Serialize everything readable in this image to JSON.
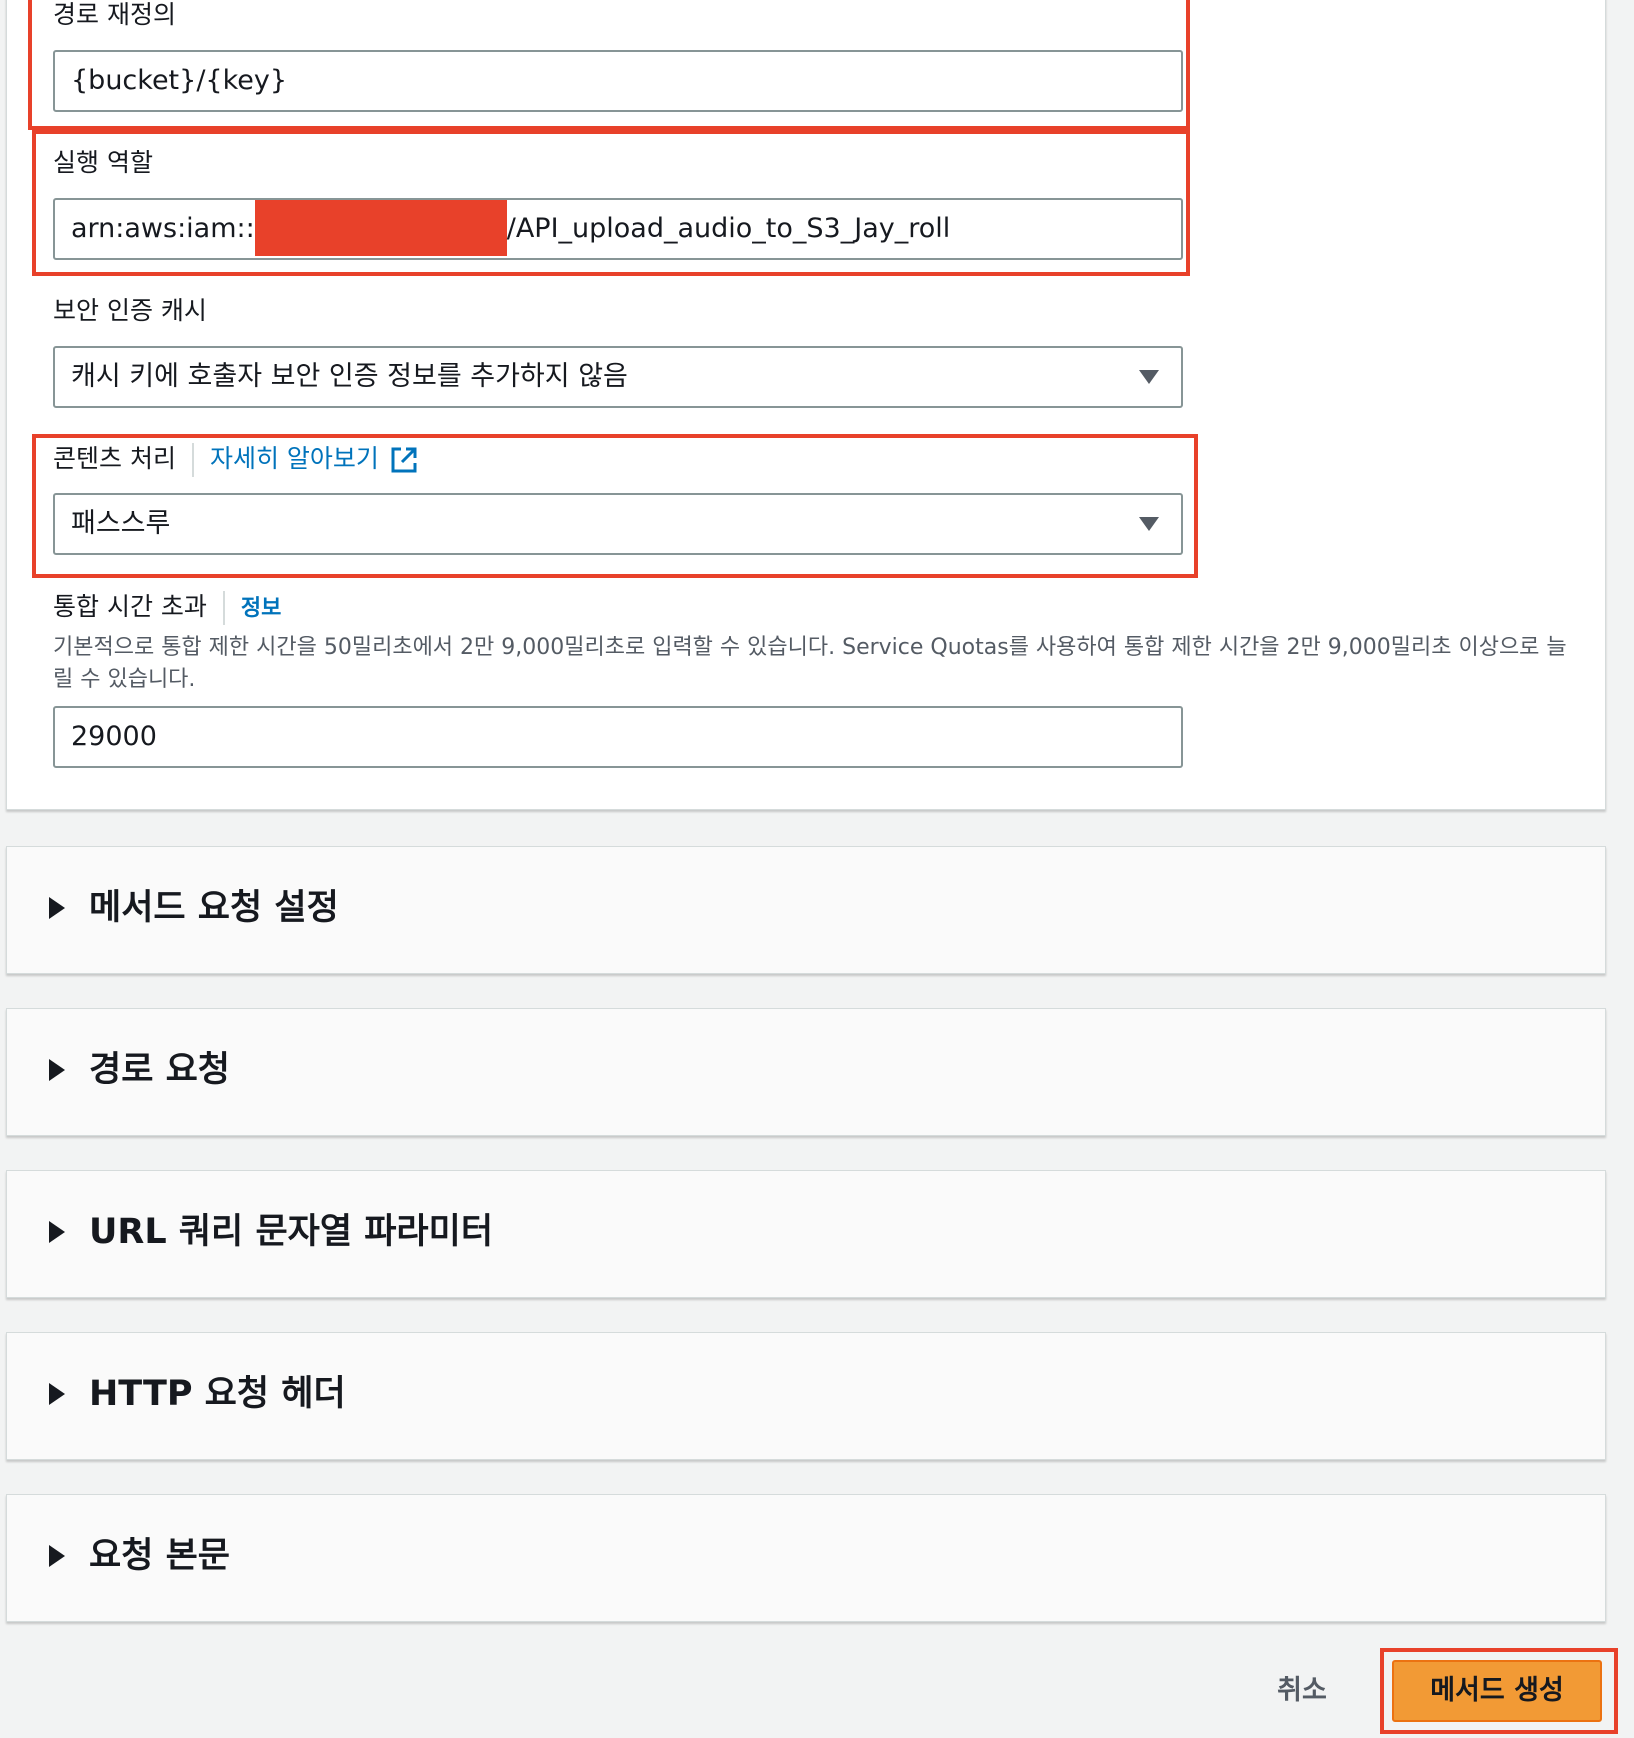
{
  "integration": {
    "path_override": {
      "label": "경로 재정의",
      "value": "{bucket}/{key}"
    },
    "execution_role": {
      "label": "실행 역할",
      "value_prefix": "arn:aws:iam::",
      "value_suffix": "/API_upload_audio_to_S3_Jay_roll"
    },
    "credential_cache": {
      "label": "보안 인증 캐시",
      "selected": "캐시 키에 호출자 보안 인증 정보를 추가하지 않음"
    },
    "content_handling": {
      "label": "콘텐츠 처리",
      "link": "자세히 알아보기",
      "selected": "패스스루"
    },
    "timeout": {
      "label": "통합 시간 초과",
      "info": "정보",
      "description": "기본적으로 통합 제한 시간을 50밀리초에서 2만 9,000밀리초로 입력할 수 있습니다. Service Quotas를 사용하여 통합 제한 시간을 2만 9,000밀리초 이상으로 늘릴 수 있습니다.",
      "value": "29000"
    }
  },
  "sections": [
    {
      "title": "메서드 요청 설정"
    },
    {
      "title": "경로 요청"
    },
    {
      "title": "URL 쿼리 문자열 파라미터"
    },
    {
      "title": "HTTP 요청 헤더"
    },
    {
      "title": "요청 본문"
    }
  ],
  "footer": {
    "cancel_label": "취소",
    "create_label": "메서드 생성"
  },
  "colors": {
    "highlight": "#e8412a",
    "primary_button": "#f29a35",
    "link": "#0073bb"
  }
}
